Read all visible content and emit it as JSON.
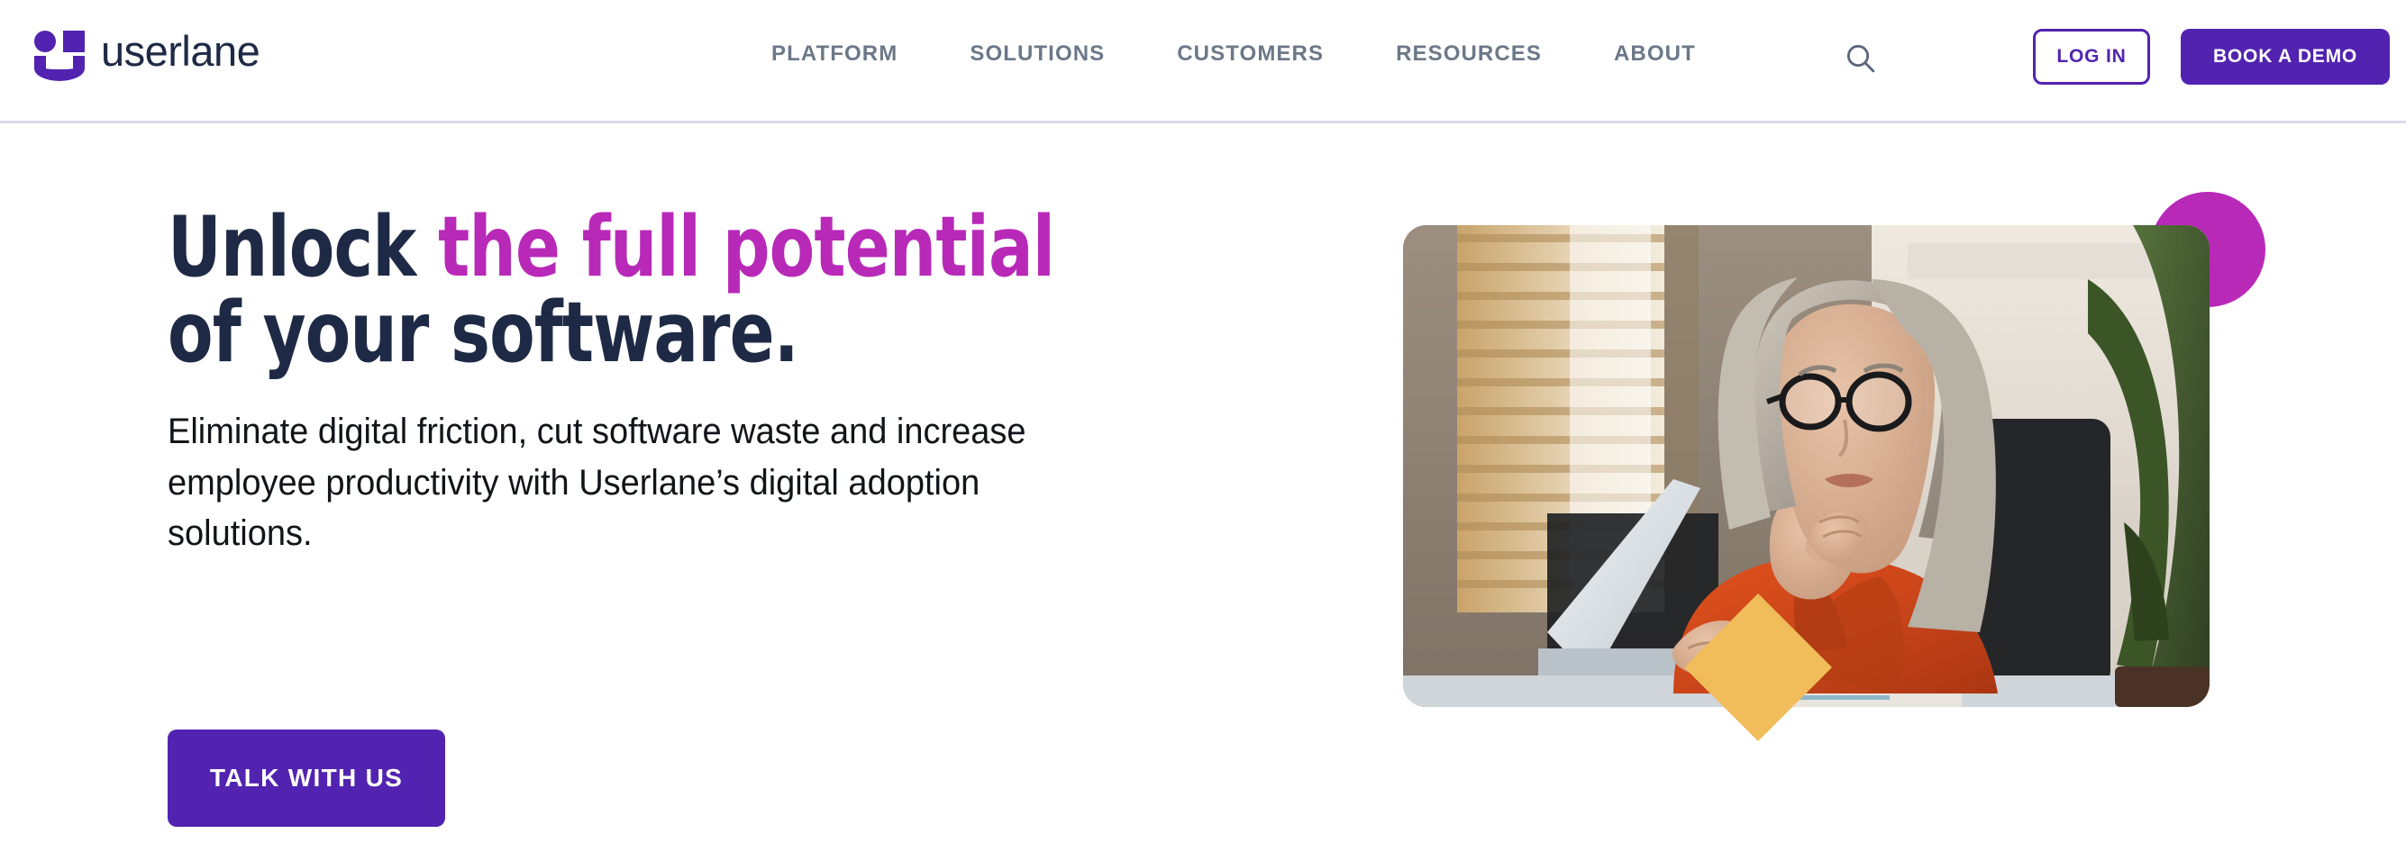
{
  "brand": {
    "name": "userlane",
    "logo_mark_icon": "userlane-smiley-icon",
    "purple": "#5223b0",
    "magenta": "#b829b8",
    "navy": "#1e2a45",
    "amber": "#f0bd5a",
    "nav_text": "#6b7888",
    "divider": "#ddd8ec"
  },
  "header": {
    "nav": [
      {
        "label": "PLATFORM"
      },
      {
        "label": "SOLUTIONS"
      },
      {
        "label": "CUSTOMERS"
      },
      {
        "label": "RESOURCES"
      },
      {
        "label": "ABOUT"
      }
    ],
    "search_icon": "search-icon",
    "login_label": "LOG IN",
    "demo_label": "BOOK A DEMO"
  },
  "hero": {
    "headline_line1_part1": "Unlock ",
    "headline_line1_accent": "the full potential",
    "headline_line2": "of your software.",
    "subcopy": "Eliminate digital friction, cut software waste and increase employee productivity with Userlane’s digital adoption solutions.",
    "cta_label": "TALK WITH US",
    "image_alt": "Mature woman with gray hair and glasses in an orange blouse, hand on chin, working at a laptop by a window with wooden blinds and a plant",
    "decor_circle_icon": "magenta-circle-decoration",
    "decor_diamond_icon": "amber-diamond-decoration"
  }
}
